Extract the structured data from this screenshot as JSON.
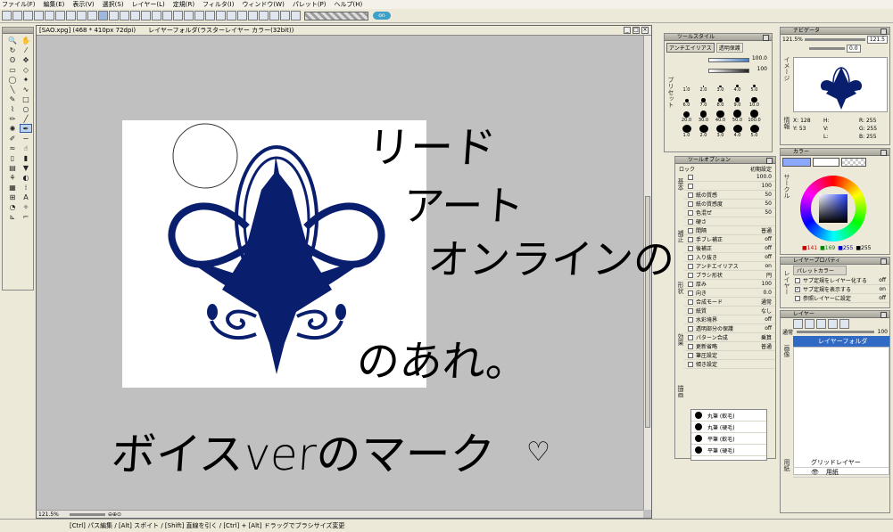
{
  "menu": [
    "ファイル(F)",
    "編集(E)",
    "表示(V)",
    "選択(S)",
    "レイヤー(L)",
    "定規(R)",
    "フィルタ(I)",
    "ウィンドウ(W)",
    "パレット(P)",
    "ヘルプ(H)"
  ],
  "canvas": {
    "tab_title": "[SAO.xpg] (468 * 410px 72dpi)",
    "layer_title": "レイヤーフォルダ(ラスターレイヤー カラー(32bit))",
    "zoom": "121.5%"
  },
  "handwriting": {
    "line1": "リード",
    "line2": "アート",
    "line3": "オンラインの",
    "line4": "のあれ。",
    "line5": "ボイスverのマーク"
  },
  "tool_style": {
    "title": "ツールスタイル",
    "tab_antialias": "アンチエイリアス",
    "tab_transparent": "透明保護",
    "val1": "100.0",
    "val2": "100",
    "preset_label": "プリセット",
    "brush_sizes_row1": [
      "1.0",
      "2.0",
      "3.0",
      "4.0",
      "5.0"
    ],
    "brush_sizes_row2": [
      "6.0",
      "7.0",
      "8.0",
      "9.0",
      "10.0"
    ],
    "brush_sizes_row3": [
      "20.0",
      "30.0",
      "40.0",
      "50.0",
      "100.0"
    ],
    "brush_sizes_row4": [
      "1.0",
      "2.0",
      "3.0",
      "4.0",
      "5.0"
    ]
  },
  "tool_option": {
    "title": "ツールオプション",
    "lock": "ロック",
    "reset": "初期設定",
    "rows": [
      {
        "label": "",
        "val": "100.0"
      },
      {
        "label": "",
        "val": "100"
      },
      {
        "label": "紙の質感",
        "val": "50"
      },
      {
        "label": "紙の質感度",
        "val": "50"
      },
      {
        "label": "色混ぜ",
        "val": "50"
      },
      {
        "label": "硬さ",
        "val": ""
      },
      {
        "label": "間隔",
        "val": "普通"
      },
      {
        "label": "手ブレ補正",
        "val": "off"
      },
      {
        "label": "後補正",
        "val": "off"
      },
      {
        "label": "入り抜き",
        "val": "off"
      },
      {
        "label": "アンチエイリアス",
        "val": "on"
      },
      {
        "label": "ブラシ形状",
        "val": "円"
      },
      {
        "label": "厚み",
        "val": "100"
      },
      {
        "label": "向き",
        "val": "0.0"
      },
      {
        "label": "合成モード",
        "val": "通常"
      },
      {
        "label": "紙質",
        "val": "なし"
      },
      {
        "label": "水彩境界",
        "val": "off"
      },
      {
        "label": "透明部分の保護",
        "val": "off"
      },
      {
        "label": "パターン合成",
        "val": "乗算"
      },
      {
        "label": "更新省略",
        "val": "普通"
      },
      {
        "label": "筆圧設定",
        "val": ""
      },
      {
        "label": "傾き設定",
        "val": ""
      }
    ],
    "side_tabs": [
      "基本",
      "補正",
      "形状",
      "効果",
      "描画"
    ]
  },
  "brush_list": [
    "丸筆 (軟毛)",
    "丸筆 (硬毛)",
    "平筆 (軟毛)",
    "平筆 (硬毛)"
  ],
  "navigator": {
    "title": "ナビゲータ",
    "zoom": "121.5%",
    "zoom_input": "121.5",
    "angle": "0.0",
    "side_tab": "イメージ",
    "info_tab": "情報",
    "x_label": "X:",
    "x_val": "128",
    "y_label": "Y:",
    "y_val": "53",
    "h_label": "H:",
    "v_label": "V:",
    "l_label": "L:",
    "r_label": "R:",
    "r_val": "255",
    "g_label": "G:",
    "g_val": "255",
    "b_label": "B:",
    "b_val": "255"
  },
  "color": {
    "title": "カラー",
    "side_tab": "サークル",
    "r": "141",
    "g": "169",
    "b": "255",
    "a": "255",
    "main_color": "#8ca9ff"
  },
  "layer_property": {
    "title": "レイヤープロパティ",
    "palette_color": "パレットカラー",
    "side_tab": "レイヤー",
    "rows": [
      {
        "label": "サブ定規をレイヤー化する",
        "val": "off"
      },
      {
        "label": "サブ定規を表示する",
        "val": "on"
      },
      {
        "label": "参照レイヤーに設定",
        "val": "off"
      }
    ]
  },
  "layers": {
    "title": "レイヤー",
    "blend": "通常",
    "opacity": "100",
    "folder": "レイヤーフォルダ",
    "side_tab": "画像",
    "side_tab2": "用紙",
    "grid": "グリッドレイヤー",
    "paper": "用紙"
  },
  "statusbar": "[Ctrl] パス編集 / [Alt] スポイト / [Shift] 直線を引く / [Ctrl] + [Alt] ドラッグでブラシサイズ変更",
  "emblem_color": "#0a1e6e"
}
